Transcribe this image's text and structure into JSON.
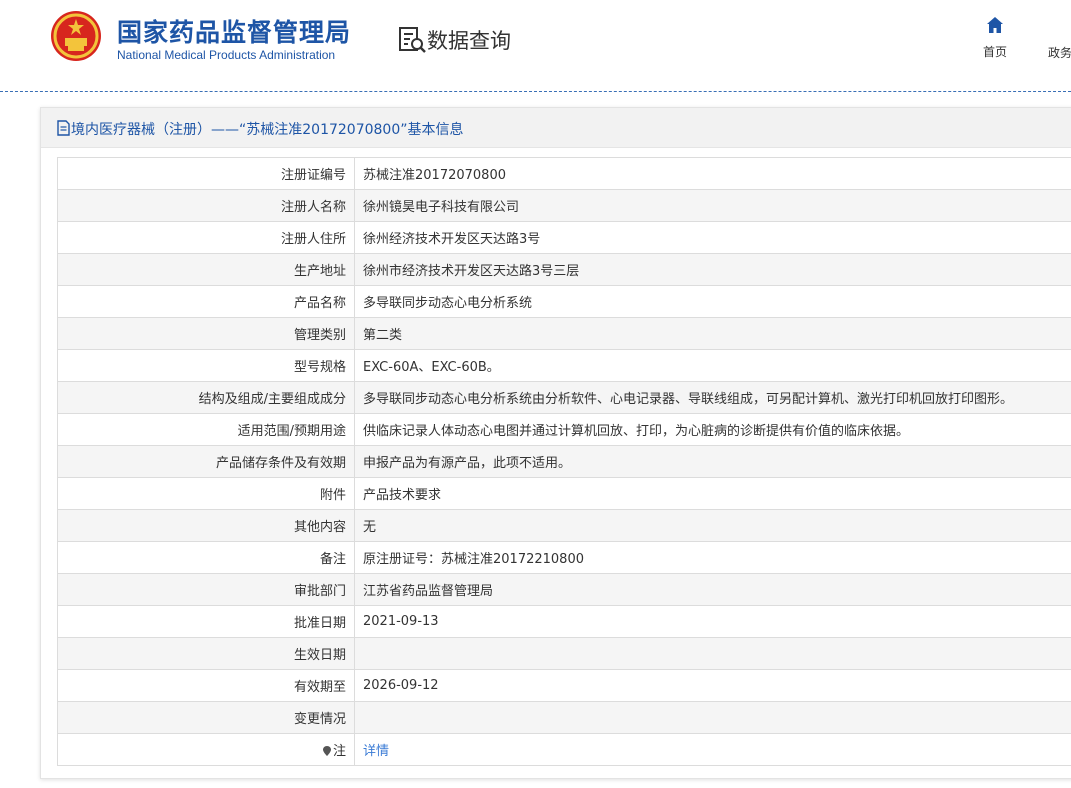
{
  "header": {
    "org_name_cn": "国家药品监督管理局",
    "org_name_en": "National Medical Products Administration",
    "query_title": "数据查询",
    "nav": {
      "home_label": "首页",
      "gov_label": "政务"
    }
  },
  "panel": {
    "title": "境内医疗器械（注册）——“苏械注准20172070800”基本信息",
    "rows": [
      {
        "label": "注册证编号",
        "value": "苏械注准20172070800"
      },
      {
        "label": "注册人名称",
        "value": "徐州镜昊电子科技有限公司"
      },
      {
        "label": "注册人住所",
        "value": "徐州经济技术开发区天达路3号"
      },
      {
        "label": "生产地址",
        "value": "徐州市经济技术开发区天达路3号三层"
      },
      {
        "label": "产品名称",
        "value": "多导联同步动态心电分析系统"
      },
      {
        "label": "管理类别",
        "value": "第二类"
      },
      {
        "label": "型号规格",
        "value": "EXC-60A、EXC-60B。"
      },
      {
        "label": "结构及组成/主要组成成分",
        "value": "多导联同步动态心电分析系统由分析软件、心电记录器、导联线组成，可另配计算机、激光打印机回放打印图形。"
      },
      {
        "label": "适用范围/预期用途",
        "value": "供临床记录人体动态心电图并通过计算机回放、打印，为心脏病的诊断提供有价值的临床依据。"
      },
      {
        "label": "产品储存条件及有效期",
        "value": "申报产品为有源产品，此项不适用。"
      },
      {
        "label": "附件",
        "value": "产品技术要求"
      },
      {
        "label": "其他内容",
        "value": "无"
      },
      {
        "label": "备注",
        "value": "原注册证号：苏械注准20172210800"
      },
      {
        "label": "审批部门",
        "value": "江苏省药品监督管理局"
      },
      {
        "label": "批准日期",
        "value": "2021-09-13"
      },
      {
        "label": "生效日期",
        "value": ""
      },
      {
        "label": "有效期至",
        "value": "2026-09-12"
      },
      {
        "label": "变更情况",
        "value": ""
      }
    ],
    "note_row": {
      "label": "注",
      "link_text": "详情"
    }
  },
  "colors": {
    "brand_blue": "#1e55a6",
    "link_blue": "#3a7bd5",
    "row_alt": "#f5f5f5"
  },
  "icons": {
    "emblem": "national-emblem-icon",
    "query": "document-search-icon",
    "home": "home-icon",
    "panel_head": "document-icon",
    "note": "pin-icon"
  }
}
